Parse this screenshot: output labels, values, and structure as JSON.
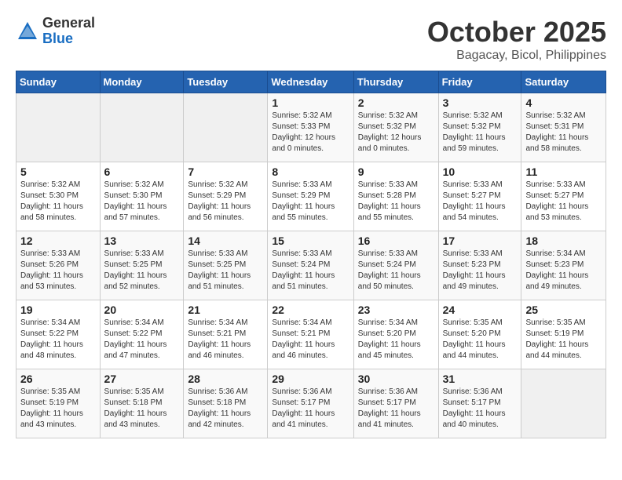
{
  "logo": {
    "general": "General",
    "blue": "Blue"
  },
  "header": {
    "month": "October 2025",
    "location": "Bagacay, Bicol, Philippines"
  },
  "weekdays": [
    "Sunday",
    "Monday",
    "Tuesday",
    "Wednesday",
    "Thursday",
    "Friday",
    "Saturday"
  ],
  "weeks": [
    [
      {
        "day": "",
        "sunrise": "",
        "sunset": "",
        "daylight": ""
      },
      {
        "day": "",
        "sunrise": "",
        "sunset": "",
        "daylight": ""
      },
      {
        "day": "",
        "sunrise": "",
        "sunset": "",
        "daylight": ""
      },
      {
        "day": "1",
        "sunrise": "Sunrise: 5:32 AM",
        "sunset": "Sunset: 5:33 PM",
        "daylight": "Daylight: 12 hours and 0 minutes."
      },
      {
        "day": "2",
        "sunrise": "Sunrise: 5:32 AM",
        "sunset": "Sunset: 5:32 PM",
        "daylight": "Daylight: 12 hours and 0 minutes."
      },
      {
        "day": "3",
        "sunrise": "Sunrise: 5:32 AM",
        "sunset": "Sunset: 5:32 PM",
        "daylight": "Daylight: 11 hours and 59 minutes."
      },
      {
        "day": "4",
        "sunrise": "Sunrise: 5:32 AM",
        "sunset": "Sunset: 5:31 PM",
        "daylight": "Daylight: 11 hours and 58 minutes."
      }
    ],
    [
      {
        "day": "5",
        "sunrise": "Sunrise: 5:32 AM",
        "sunset": "Sunset: 5:30 PM",
        "daylight": "Daylight: 11 hours and 58 minutes."
      },
      {
        "day": "6",
        "sunrise": "Sunrise: 5:32 AM",
        "sunset": "Sunset: 5:30 PM",
        "daylight": "Daylight: 11 hours and 57 minutes."
      },
      {
        "day": "7",
        "sunrise": "Sunrise: 5:32 AM",
        "sunset": "Sunset: 5:29 PM",
        "daylight": "Daylight: 11 hours and 56 minutes."
      },
      {
        "day": "8",
        "sunrise": "Sunrise: 5:33 AM",
        "sunset": "Sunset: 5:29 PM",
        "daylight": "Daylight: 11 hours and 55 minutes."
      },
      {
        "day": "9",
        "sunrise": "Sunrise: 5:33 AM",
        "sunset": "Sunset: 5:28 PM",
        "daylight": "Daylight: 11 hours and 55 minutes."
      },
      {
        "day": "10",
        "sunrise": "Sunrise: 5:33 AM",
        "sunset": "Sunset: 5:27 PM",
        "daylight": "Daylight: 11 hours and 54 minutes."
      },
      {
        "day": "11",
        "sunrise": "Sunrise: 5:33 AM",
        "sunset": "Sunset: 5:27 PM",
        "daylight": "Daylight: 11 hours and 53 minutes."
      }
    ],
    [
      {
        "day": "12",
        "sunrise": "Sunrise: 5:33 AM",
        "sunset": "Sunset: 5:26 PM",
        "daylight": "Daylight: 11 hours and 53 minutes."
      },
      {
        "day": "13",
        "sunrise": "Sunrise: 5:33 AM",
        "sunset": "Sunset: 5:25 PM",
        "daylight": "Daylight: 11 hours and 52 minutes."
      },
      {
        "day": "14",
        "sunrise": "Sunrise: 5:33 AM",
        "sunset": "Sunset: 5:25 PM",
        "daylight": "Daylight: 11 hours and 51 minutes."
      },
      {
        "day": "15",
        "sunrise": "Sunrise: 5:33 AM",
        "sunset": "Sunset: 5:24 PM",
        "daylight": "Daylight: 11 hours and 51 minutes."
      },
      {
        "day": "16",
        "sunrise": "Sunrise: 5:33 AM",
        "sunset": "Sunset: 5:24 PM",
        "daylight": "Daylight: 11 hours and 50 minutes."
      },
      {
        "day": "17",
        "sunrise": "Sunrise: 5:33 AM",
        "sunset": "Sunset: 5:23 PM",
        "daylight": "Daylight: 11 hours and 49 minutes."
      },
      {
        "day": "18",
        "sunrise": "Sunrise: 5:34 AM",
        "sunset": "Sunset: 5:23 PM",
        "daylight": "Daylight: 11 hours and 49 minutes."
      }
    ],
    [
      {
        "day": "19",
        "sunrise": "Sunrise: 5:34 AM",
        "sunset": "Sunset: 5:22 PM",
        "daylight": "Daylight: 11 hours and 48 minutes."
      },
      {
        "day": "20",
        "sunrise": "Sunrise: 5:34 AM",
        "sunset": "Sunset: 5:22 PM",
        "daylight": "Daylight: 11 hours and 47 minutes."
      },
      {
        "day": "21",
        "sunrise": "Sunrise: 5:34 AM",
        "sunset": "Sunset: 5:21 PM",
        "daylight": "Daylight: 11 hours and 46 minutes."
      },
      {
        "day": "22",
        "sunrise": "Sunrise: 5:34 AM",
        "sunset": "Sunset: 5:21 PM",
        "daylight": "Daylight: 11 hours and 46 minutes."
      },
      {
        "day": "23",
        "sunrise": "Sunrise: 5:34 AM",
        "sunset": "Sunset: 5:20 PM",
        "daylight": "Daylight: 11 hours and 45 minutes."
      },
      {
        "day": "24",
        "sunrise": "Sunrise: 5:35 AM",
        "sunset": "Sunset: 5:20 PM",
        "daylight": "Daylight: 11 hours and 44 minutes."
      },
      {
        "day": "25",
        "sunrise": "Sunrise: 5:35 AM",
        "sunset": "Sunset: 5:19 PM",
        "daylight": "Daylight: 11 hours and 44 minutes."
      }
    ],
    [
      {
        "day": "26",
        "sunrise": "Sunrise: 5:35 AM",
        "sunset": "Sunset: 5:19 PM",
        "daylight": "Daylight: 11 hours and 43 minutes."
      },
      {
        "day": "27",
        "sunrise": "Sunrise: 5:35 AM",
        "sunset": "Sunset: 5:18 PM",
        "daylight": "Daylight: 11 hours and 43 minutes."
      },
      {
        "day": "28",
        "sunrise": "Sunrise: 5:36 AM",
        "sunset": "Sunset: 5:18 PM",
        "daylight": "Daylight: 11 hours and 42 minutes."
      },
      {
        "day": "29",
        "sunrise": "Sunrise: 5:36 AM",
        "sunset": "Sunset: 5:17 PM",
        "daylight": "Daylight: 11 hours and 41 minutes."
      },
      {
        "day": "30",
        "sunrise": "Sunrise: 5:36 AM",
        "sunset": "Sunset: 5:17 PM",
        "daylight": "Daylight: 11 hours and 41 minutes."
      },
      {
        "day": "31",
        "sunrise": "Sunrise: 5:36 AM",
        "sunset": "Sunset: 5:17 PM",
        "daylight": "Daylight: 11 hours and 40 minutes."
      },
      {
        "day": "",
        "sunrise": "",
        "sunset": "",
        "daylight": ""
      }
    ]
  ]
}
